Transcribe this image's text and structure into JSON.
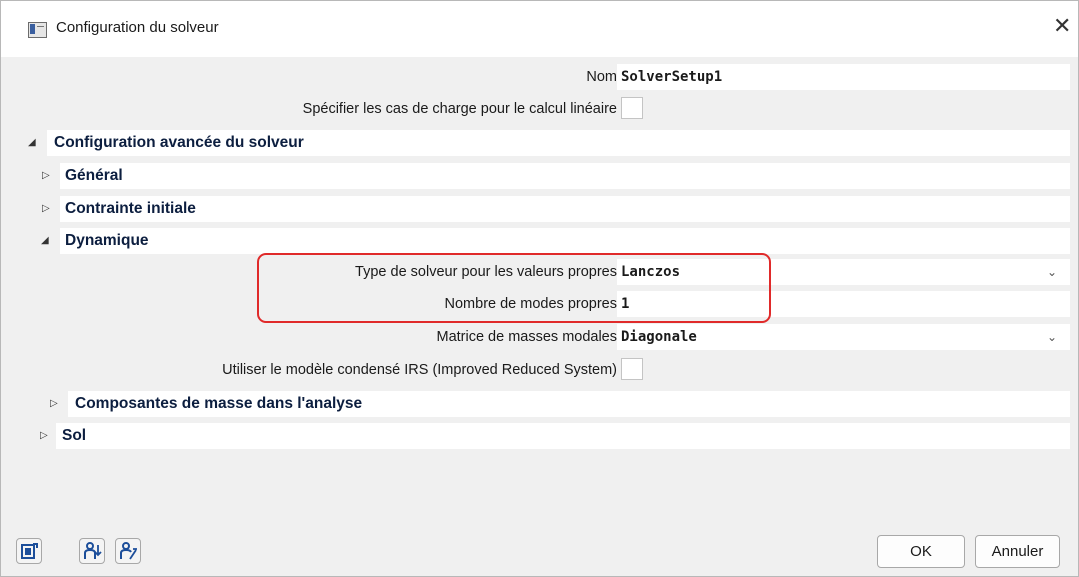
{
  "window": {
    "title": "Configuration du solveur"
  },
  "rows": {
    "nom": {
      "label": "Nom",
      "value": "SolverSetup1"
    },
    "specifier": {
      "label": "Spécifier les cas de charge pour le calcul linéaire"
    },
    "config_avancee": {
      "label": "Configuration avancée du solveur"
    },
    "general": {
      "label": "Général"
    },
    "contrainte": {
      "label": "Contrainte initiale"
    },
    "dynamique": {
      "label": "Dynamique"
    },
    "type_solveur": {
      "label": "Type de solveur pour les valeurs propres",
      "value": "Lanczos"
    },
    "nombre_modes": {
      "label": "Nombre de modes propres",
      "value": "1"
    },
    "matrice": {
      "label": "Matrice de masses modales",
      "value": "Diagonale"
    },
    "irs": {
      "label": "Utiliser le modèle condensé IRS (Improved Reduced System)"
    },
    "composantes": {
      "label": "Composantes de masse dans l'analyse"
    },
    "sol": {
      "label": "Sol"
    }
  },
  "footer": {
    "ok": "OK",
    "cancel": "Annuler"
  },
  "colors": {
    "highlight": "#e02a2a",
    "section_text": "#0c1e3f",
    "icon_blue": "#1c4e9a"
  }
}
